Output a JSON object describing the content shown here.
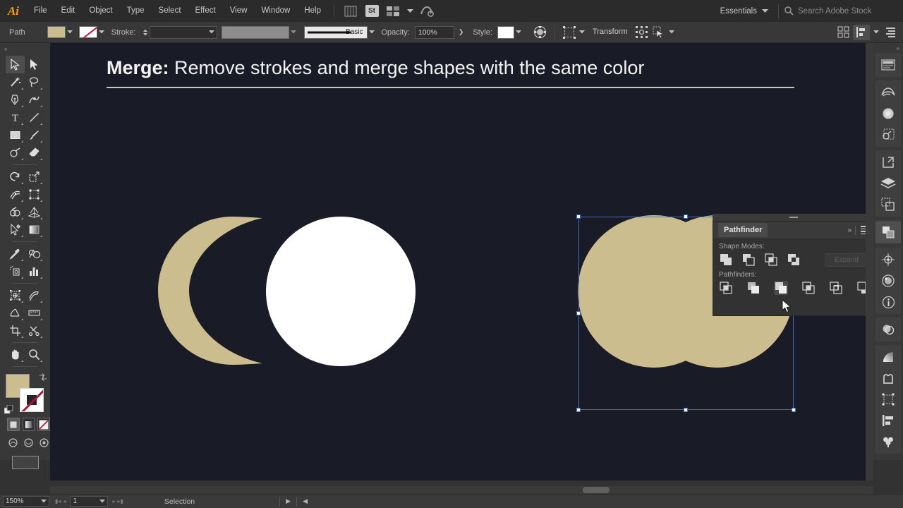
{
  "app": {
    "name": "Adobe Illustrator",
    "logo": "Ai"
  },
  "menubar": {
    "items": [
      {
        "label": "File"
      },
      {
        "label": "Edit"
      },
      {
        "label": "Object"
      },
      {
        "label": "Type"
      },
      {
        "label": "Select"
      },
      {
        "label": "Effect"
      },
      {
        "label": "View"
      },
      {
        "label": "Window"
      },
      {
        "label": "Help"
      }
    ],
    "icons": [
      {
        "name": "bridge-icon"
      },
      {
        "name": "stock-icon",
        "label": "St"
      },
      {
        "name": "arrange-documents-icon"
      },
      {
        "name": "cc-libraries-icon"
      }
    ],
    "workspace": {
      "label": "Essentials",
      "caret": "⌄"
    },
    "search": {
      "placeholder": "Search Adobe Stock",
      "icon": "search-icon"
    }
  },
  "controlbar": {
    "object_label": "Path",
    "fill_color": "#ccbd8e",
    "stroke_color": "none",
    "stroke_label": "Stroke:",
    "stroke_weight": "",
    "stroke_profile": "",
    "brush_label": "Basic",
    "opacity_label": "Opacity:",
    "opacity_value": "100%",
    "style_label": "Style:",
    "transform_label": "Transform",
    "icons": [
      {
        "name": "recolor-artwork-icon"
      },
      {
        "name": "select-similar-icon"
      },
      {
        "name": "isolate-group-icon"
      },
      {
        "name": "selection-options-icon"
      },
      {
        "name": "distribute-spacing-icon"
      },
      {
        "name": "align-icon"
      },
      {
        "name": "document-setup-icon"
      }
    ]
  },
  "toolbar": {
    "tools": [
      {
        "name": "selection-tool",
        "selected": true
      },
      {
        "name": "direct-selection-tool",
        "selected": false
      },
      {
        "name": "magic-wand-tool",
        "selected": false
      },
      {
        "name": "lasso-tool",
        "selected": false
      },
      {
        "name": "pen-tool",
        "selected": false
      },
      {
        "name": "curvature-tool",
        "selected": false
      },
      {
        "name": "type-tool",
        "selected": false
      },
      {
        "name": "line-segment-tool",
        "selected": false
      },
      {
        "name": "rectangle-tool",
        "selected": false
      },
      {
        "name": "paintbrush-tool",
        "selected": false
      },
      {
        "name": "shaper-tool",
        "selected": false
      },
      {
        "name": "eraser-tool",
        "selected": false
      },
      {
        "name": "rotate-tool",
        "selected": false
      },
      {
        "name": "scale-tool",
        "selected": false
      },
      {
        "name": "width-tool",
        "selected": false
      },
      {
        "name": "free-transform-tool",
        "selected": false
      },
      {
        "name": "shape-builder-tool",
        "selected": false
      },
      {
        "name": "perspective-grid-tool",
        "selected": false
      },
      {
        "name": "mesh-tool",
        "selected": false
      },
      {
        "name": "gradient-tool",
        "selected": false
      },
      {
        "name": "eyedropper-tool",
        "selected": false
      },
      {
        "name": "blend-tool",
        "selected": false
      },
      {
        "name": "symbol-sprayer-tool",
        "selected": false
      },
      {
        "name": "column-graph-tool",
        "selected": false
      },
      {
        "name": "artboard-tool",
        "selected": false
      },
      {
        "name": "slice-tool",
        "selected": false
      },
      {
        "name": "perspective-selection-tool",
        "selected": false
      },
      {
        "name": "measure-tool",
        "selected": false
      },
      {
        "name": "crop-image-tool",
        "selected": false
      },
      {
        "name": "scissors-tool",
        "selected": false
      },
      {
        "name": "hand-tool",
        "selected": false
      },
      {
        "name": "zoom-tool",
        "selected": false
      }
    ],
    "fill_color": "#ccbd8e",
    "stroke_color": "none",
    "color_modes": [
      {
        "name": "color-mode-button",
        "selected": true
      },
      {
        "name": "gradient-mode-button",
        "selected": false
      },
      {
        "name": "none-mode-button",
        "selected": false
      }
    ],
    "screen_modes": [
      {
        "name": "draw-normal-button"
      },
      {
        "name": "draw-behind-button"
      },
      {
        "name": "draw-inside-button"
      }
    ],
    "change-screen-mode": "change-screen-mode-button"
  },
  "canvas": {
    "title_bold": "Merge:",
    "title_rest": " Remove strokes and merge shapes with the same color",
    "shapes": [
      {
        "name": "crescent-shape",
        "color": "#ccbd8e"
      },
      {
        "name": "circle-shape",
        "color": "#ffffff"
      },
      {
        "name": "merged-shape",
        "color": "#ccbd8e",
        "selected": true
      }
    ],
    "selection_color": "#3f6fc4",
    "background": "#191c26"
  },
  "pathfinder": {
    "title": "Pathfinder",
    "collapse_icon": "double-chevron-right-icon",
    "menu_icon": "panel-menu-icon",
    "shape_modes_label": "Shape Modes:",
    "shape_modes": [
      {
        "name": "unite-button"
      },
      {
        "name": "minus-front-button"
      },
      {
        "name": "intersect-button"
      },
      {
        "name": "exclude-button"
      }
    ],
    "expand_label": "Expand",
    "expand_enabled": false,
    "pathfinders_label": "Pathfinders:",
    "pathfinders": [
      {
        "name": "divide-button",
        "highlighted": false
      },
      {
        "name": "trim-button",
        "highlighted": false
      },
      {
        "name": "merge-button",
        "highlighted": true
      },
      {
        "name": "crop-button",
        "highlighted": false
      },
      {
        "name": "outline-button",
        "highlighted": false
      },
      {
        "name": "minus-back-button",
        "highlighted": false
      }
    ]
  },
  "right_dock": {
    "groups": [
      [
        {
          "name": "properties-panel-icon",
          "selected": false
        }
      ],
      [
        {
          "name": "cc-libraries-panel-icon",
          "selected": false
        },
        {
          "name": "color-panel-icon",
          "selected": false
        },
        {
          "name": "color-guide-panel-icon",
          "selected": false
        }
      ],
      [
        {
          "name": "export-panel-icon",
          "selected": false
        },
        {
          "name": "layers-panel-icon",
          "selected": false
        },
        {
          "name": "artboards-panel-icon",
          "selected": false
        }
      ],
      [
        {
          "name": "pathfinder-panel-icon",
          "selected": true
        }
      ],
      [
        {
          "name": "transform-panel-icon",
          "selected": false
        },
        {
          "name": "appearance-panel-icon",
          "selected": false
        },
        {
          "name": "info-panel-icon",
          "selected": false
        }
      ],
      [
        {
          "name": "transparency-panel-icon",
          "selected": false
        }
      ],
      [
        {
          "name": "gradient-panel-icon",
          "selected": false
        },
        {
          "name": "symbols-panel-icon",
          "selected": false
        },
        {
          "name": "artboard-tool-panel-icon",
          "selected": false
        },
        {
          "name": "align-panel-icon",
          "selected": false
        },
        {
          "name": "brushes-panel-icon",
          "selected": false
        }
      ]
    ]
  },
  "statusbar": {
    "zoom_level": "150%",
    "zoom_caret": "⌄",
    "page_number": "1",
    "page_caret": "⌄",
    "status_text": "Selection",
    "first_page_icon": "first-page-icon",
    "prev_page_icon": "prev-page-icon",
    "next_page_icon": "next-page-icon",
    "last_page_icon": "last-page-icon",
    "play_icon": "play-icon",
    "back-icon": "back-icon"
  }
}
